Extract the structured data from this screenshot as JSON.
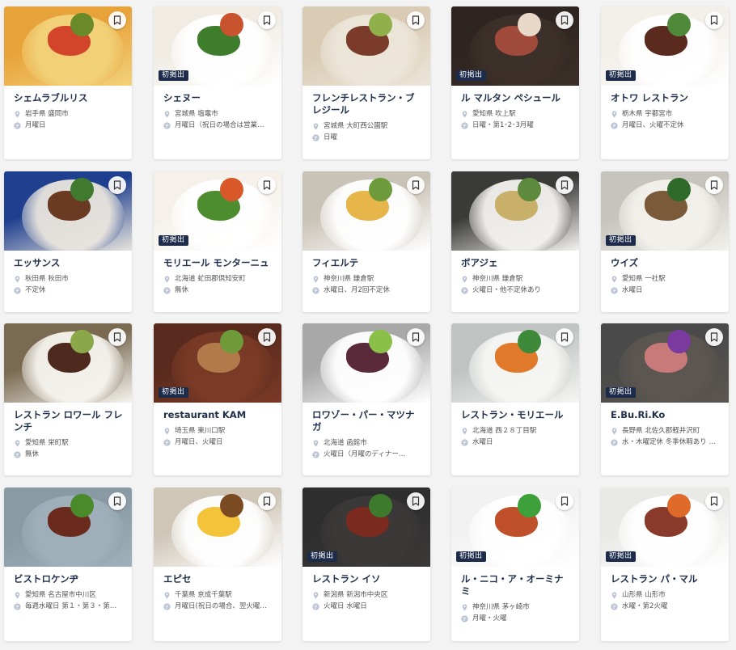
{
  "colors": {
    "page_bg": "#f3f3f3",
    "card_bg": "#ffffff",
    "title": "#20304c",
    "badge_bg": "#1c2c4a",
    "meta_text": "#555555",
    "icon": "#b8c2d3"
  },
  "icons": {
    "bookmark": "bookmark-icon",
    "location": "location-pin-icon",
    "closed_day": "calendar-closed-icon"
  },
  "new_badge_label": "初掲出",
  "restaurants": [
    {
      "name": "シェムラブルリス",
      "location": "岩手県 盛岡市",
      "closed": "月曜日",
      "new": false
    },
    {
      "name": "シェヌー",
      "location": "宮城県 塩竈市",
      "closed": "月曜日（祝日の場合は営業…",
      "new": true
    },
    {
      "name": "フレンチレストラン・ブレジール",
      "location": "宮城県 大町西公園駅",
      "closed": "日曜",
      "new": false
    },
    {
      "name": "ル マルタン ペシュール",
      "location": "愛知県 吹上駅",
      "closed": "日曜・第1･2･3月曜",
      "new": true
    },
    {
      "name": "オトワ レストラン",
      "location": "栃木県 宇都宮市",
      "closed": "月曜日、火曜不定休",
      "new": true
    },
    {
      "name": "エッサンス",
      "location": "秋田県 秋田市",
      "closed": "不定休",
      "new": false
    },
    {
      "name": "モリエール モンターニュ",
      "location": "北海道 虻田郡倶知安町",
      "closed": "無休",
      "new": true
    },
    {
      "name": "フィエルテ",
      "location": "神奈川県 鎌倉駅",
      "closed": "水曜日、月2回不定休",
      "new": false
    },
    {
      "name": "ボアジェ",
      "location": "神奈川県 鎌倉駅",
      "closed": "火曜日・他不定休あり",
      "new": false
    },
    {
      "name": "ウイズ",
      "location": "愛知県 一社駅",
      "closed": "水曜日",
      "new": true
    },
    {
      "name": "レストラン ロワール フレンチ",
      "location": "愛知県 栄町駅",
      "closed": "無休",
      "new": false
    },
    {
      "name": "restaurant KAM",
      "location": "埼玉県 東川口駅",
      "closed": "月曜日、火曜日",
      "new": true
    },
    {
      "name": "ロワゾー・パー・マツナガ",
      "location": "北海道 函館市",
      "closed": "火曜日（月曜のディナー…",
      "new": false
    },
    {
      "name": "レストラン・モリエール",
      "location": "北海道 西２８丁目駅",
      "closed": "水曜日",
      "new": false
    },
    {
      "name": "E.Bu.Ri.Ko",
      "location": "長野県 北佐久郡軽井沢町",
      "closed": "水・木曜定休 冬季休暇あり …",
      "new": true
    },
    {
      "name": "ビストロケンヂ",
      "location": "愛知県 名古屋市中川区",
      "closed": "毎週水曜日 第１・第３・第…",
      "new": false
    },
    {
      "name": "エピセ",
      "location": "千葉県 京成千葉駅",
      "closed": "月曜日(祝日の場合、翌火曜…",
      "new": false
    },
    {
      "name": "レストラン イソ",
      "location": "新潟県 新潟市中央区",
      "closed": "火曜日 水曜日",
      "new": true
    },
    {
      "name": "ル・ニコ・ア・オーミナミ",
      "location": "神奈川県 茅ヶ崎市",
      "closed": "月曜・火曜",
      "new": true
    },
    {
      "name": "レストラン パ・マル",
      "location": "山形県 山形市",
      "closed": "水曜・第2火曜",
      "new": true
    }
  ]
}
